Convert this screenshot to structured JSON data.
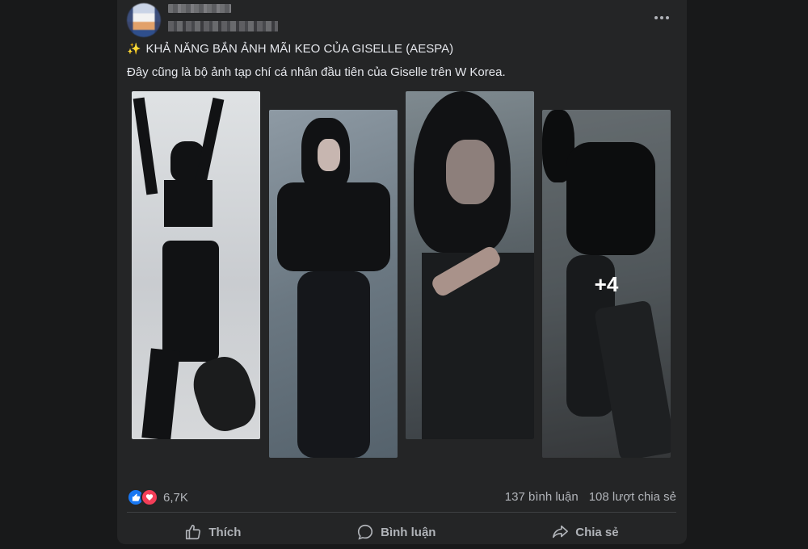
{
  "post": {
    "title_emoji": "✨",
    "title": "KHẢ NĂNG BẮN ẢNH MÃI KEO CỦA GISELLE (AESPA)",
    "text": "Đây cũng là bộ ảnh tạp chí cá nhân đầu tiên của Giselle trên W Korea.",
    "more_photos_label": "+4",
    "reaction_count": "6,7K",
    "comments_label": "137 bình luận",
    "shares_label": "108 lượt chia sẻ"
  },
  "actions": {
    "like_label": "Thích",
    "comment_label": "Bình luận",
    "share_label": "Chia sẻ"
  },
  "icons": {
    "more": "more-horizontal-icon",
    "like": "thumbs-up-icon",
    "comment": "speech-bubble-icon",
    "share": "share-arrow-icon",
    "reaction_like": "like-reaction-icon",
    "reaction_love": "love-reaction-icon"
  },
  "colors": {
    "background": "#18191a",
    "card": "#242526",
    "primary_text": "#e4e6eb",
    "secondary_text": "#b0b3b8",
    "like_blue": "#1877f2",
    "love_red": "#f33e58"
  }
}
